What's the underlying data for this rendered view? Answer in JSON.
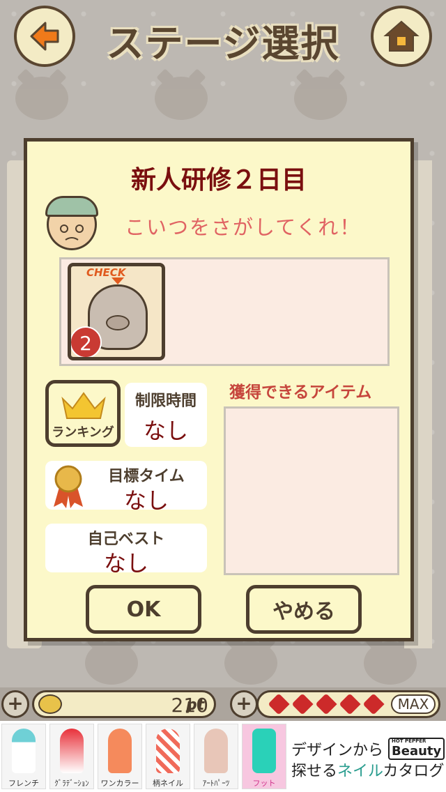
{
  "header": {
    "title": "ステージ選択",
    "back_icon": "left-arrow-icon",
    "home_icon": "house-icon"
  },
  "dialog": {
    "title": "新人研修２日目",
    "speech": "こいつをさがしてくれ！",
    "target": {
      "check_label": "CHECK",
      "count": "2"
    },
    "ranking_label": "ランキング",
    "time_limit": {
      "label": "制限時間",
      "value": "なし"
    },
    "target_time": {
      "label": "目標タイム",
      "value": "なし"
    },
    "personal_best": {
      "label": "自己ベスト",
      "value": "なし"
    },
    "items_title": "獲得できるアイテム",
    "ok_label": "OK",
    "cancel_label": "やめる"
  },
  "status_bar": {
    "points": "210",
    "points_unit": "pt",
    "hearts_count": 5,
    "hearts_status": "MAX"
  },
  "ad": {
    "tabs": [
      "フレンチ",
      "ｸﾞﾗﾃﾞｰｼｮﾝ",
      "ワンカラー",
      "柄ネイル",
      "ｱｰﾄﾊﾟｰﾂ",
      "フット"
    ],
    "line1": "デザインから",
    "brand_small": "HOT PEPPER",
    "brand": "Beauty",
    "line2_a": "探せる",
    "line2_b": "ネイル",
    "line2_c": "カタログ",
    "colors": {
      "accent_green": "#2a9d8f",
      "selected_tab": "#f7c7e0"
    }
  }
}
